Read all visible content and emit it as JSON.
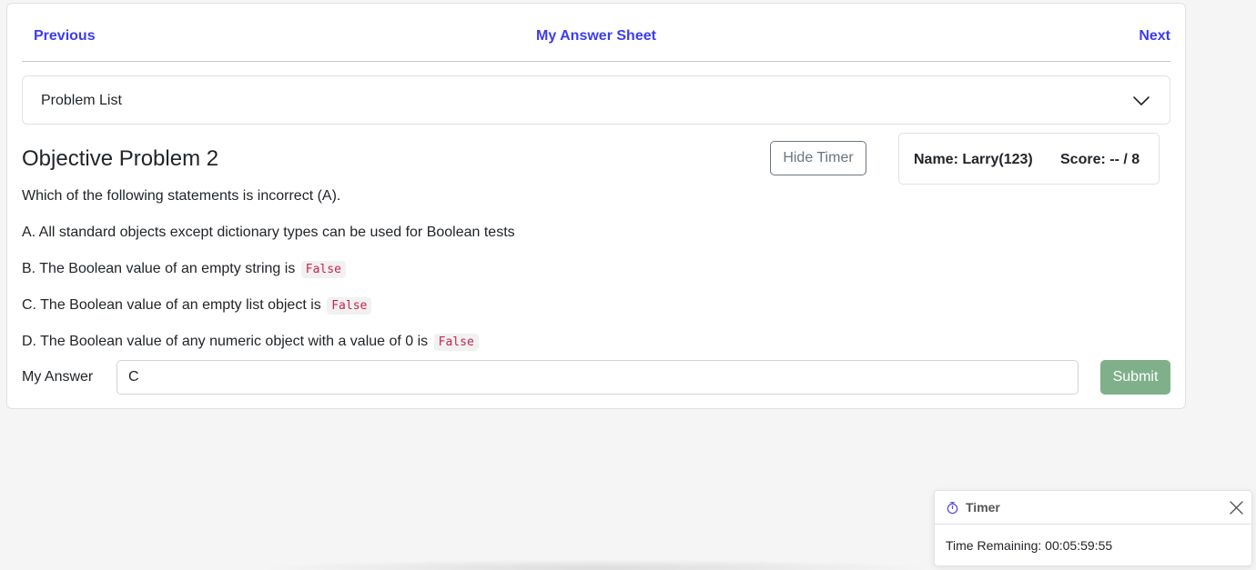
{
  "nav": {
    "previous_label": "Previous",
    "center_label": "My Answer Sheet",
    "next_label": "Next"
  },
  "problem_list": {
    "label": "Problem List",
    "chevron_icon": "chevron-down-icon"
  },
  "problem": {
    "title": "Objective Problem 2",
    "question": "Which of the following statements is incorrect (A).",
    "options": [
      {
        "text": "A. All standard objects except dictionary types can be used for Boolean tests",
        "code": ""
      },
      {
        "text": "B. The Boolean value of an empty string is",
        "code": "False"
      },
      {
        "text": "C. The Boolean value of an empty list object is",
        "code": "False"
      },
      {
        "text": "D. The Boolean value of any numeric object with a value of 0 is",
        "code": "False"
      }
    ]
  },
  "controls": {
    "hide_timer_label": "Hide Timer"
  },
  "info": {
    "name": "Name: Larry(123)",
    "score": "Score: -- / 8"
  },
  "answer": {
    "label": "My Answer",
    "value": "C",
    "submit_label": "Submit"
  },
  "timer": {
    "title": "Timer",
    "icon": "stopwatch-icon",
    "close_icon": "close-icon",
    "remaining": "Time Remaining: 00:05:59:55"
  },
  "colors": {
    "link": "#3d3cf0",
    "submit": "#7fb08a",
    "code": "#c7254e"
  }
}
